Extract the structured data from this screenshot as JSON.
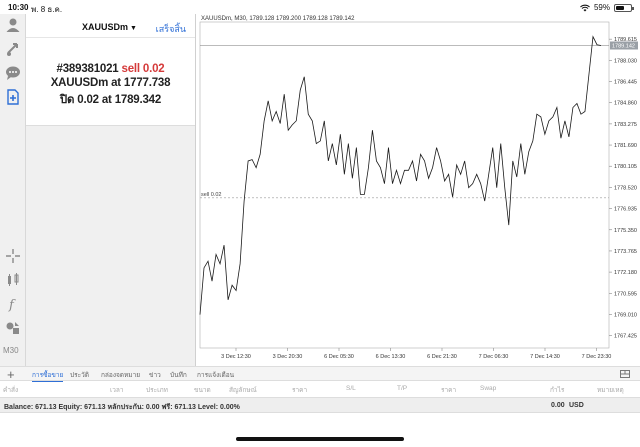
{
  "status": {
    "time": "10:30",
    "date": "พ. 8 ธ.ค.",
    "battery": "59%",
    "battery_level": 0.59
  },
  "order": {
    "symbol": "XAUUSDm",
    "done_label": "เสร็จสิ้น",
    "ticket": "#389381021",
    "side": "sell 0.02",
    "open_prefix": "XAUUSDm at",
    "open_price": "1777.738",
    "close_prefix": "ปิด 0.02 at",
    "close_price": "1789.342"
  },
  "timeframe": "M30",
  "chart_data": {
    "type": "line",
    "title": "XAUUSDm, M30, 1789.128 1789.200 1789.128 1789.142",
    "y_ticks": [
      "1789.615",
      "1788.030",
      "1786.445",
      "1784.860",
      "1783.275",
      "1781.690",
      "1780.105",
      "1778.520",
      "1776.935",
      "1775.350",
      "1773.765",
      "1772.180",
      "1770.595",
      "1769.010",
      "1767.425"
    ],
    "x_ticks": [
      "3 Dec 12:30",
      "3 Dec 20:30",
      "6 Dec 05:30",
      "6 Dec 13:30",
      "6 Dec 21:30",
      "7 Dec 06:30",
      "7 Dec 14:30",
      "7 Dec 23:30"
    ],
    "ylim": [
      1766.5,
      1790.9
    ],
    "current_price": "1789.142",
    "current_price_value": 1789.142,
    "order_line_label": "sell 0.02",
    "order_line_value": 1777.738,
    "values": [
      1769.0,
      1772.5,
      1773.0,
      1771.5,
      1773.5,
      1772.8,
      1774.2,
      1770.1,
      1771.2,
      1770.8,
      1772.8,
      1777.5,
      1780.5,
      1780.6,
      1780.0,
      1781.0,
      1783.5,
      1785.0,
      1783.5,
      1784.2,
      1783.3,
      1785.5,
      1782.8,
      1783.2,
      1783.5,
      1785.8,
      1786.8,
      1784.0,
      1783.5,
      1781.8,
      1782.0,
      1783.5,
      1780.5,
      1781.8,
      1780.2,
      1782.5,
      1779.5,
      1781.8,
      1779.2,
      1781.5,
      1778.0,
      1778.0,
      1780.0,
      1782.8,
      1780.5,
      1780.0,
      1778.8,
      1781.5,
      1778.8,
      1779.8,
      1778.8,
      1779.8,
      1779.8,
      1780.5,
      1779.0,
      1781.0,
      1780.5,
      1779.2,
      1780.0,
      1781.5,
      1780.5,
      1779.0,
      1779.5,
      1777.8,
      1780.2,
      1779.5,
      1780.5,
      1778.5,
      1778.8,
      1779.5,
      1778.8,
      1777.5,
      1779.5,
      1781.5,
      1778.5,
      1781.8,
      1778.5,
      1775.7,
      1780.5,
      1779.3,
      1781.8,
      1779.5,
      1781.2,
      1782.0,
      1784.0,
      1783.8,
      1782.5,
      1783.5,
      1783.8,
      1784.5,
      1782.2,
      1783.5,
      1782.3,
      1784.5,
      1784.8,
      1784.0,
      1784.2,
      1787.0,
      1789.8,
      1789.2,
      1789.142
    ],
    "grid": false
  },
  "tabs": [
    "การซื้อขาย",
    "ประวัติ",
    "กล่องจดหมาย",
    "ข่าว",
    "บันทึก",
    "การแจ้งเตือน"
  ],
  "columns": [
    "คำสั่ง",
    "เวลา",
    "ประเภท",
    "ขนาด",
    "สัญลักษณ์",
    "ราคา",
    "S/L",
    "T/P",
    "ราคา",
    "Swap",
    "กำไร",
    "หมายเหตุ"
  ],
  "balance": {
    "text": "Balance: 671.13 Equity: 671.13 หลักประกัน: 0.00 ฟรี: 671.13 Level: 0.00%",
    "profit": "0.00",
    "currency": "USD"
  }
}
